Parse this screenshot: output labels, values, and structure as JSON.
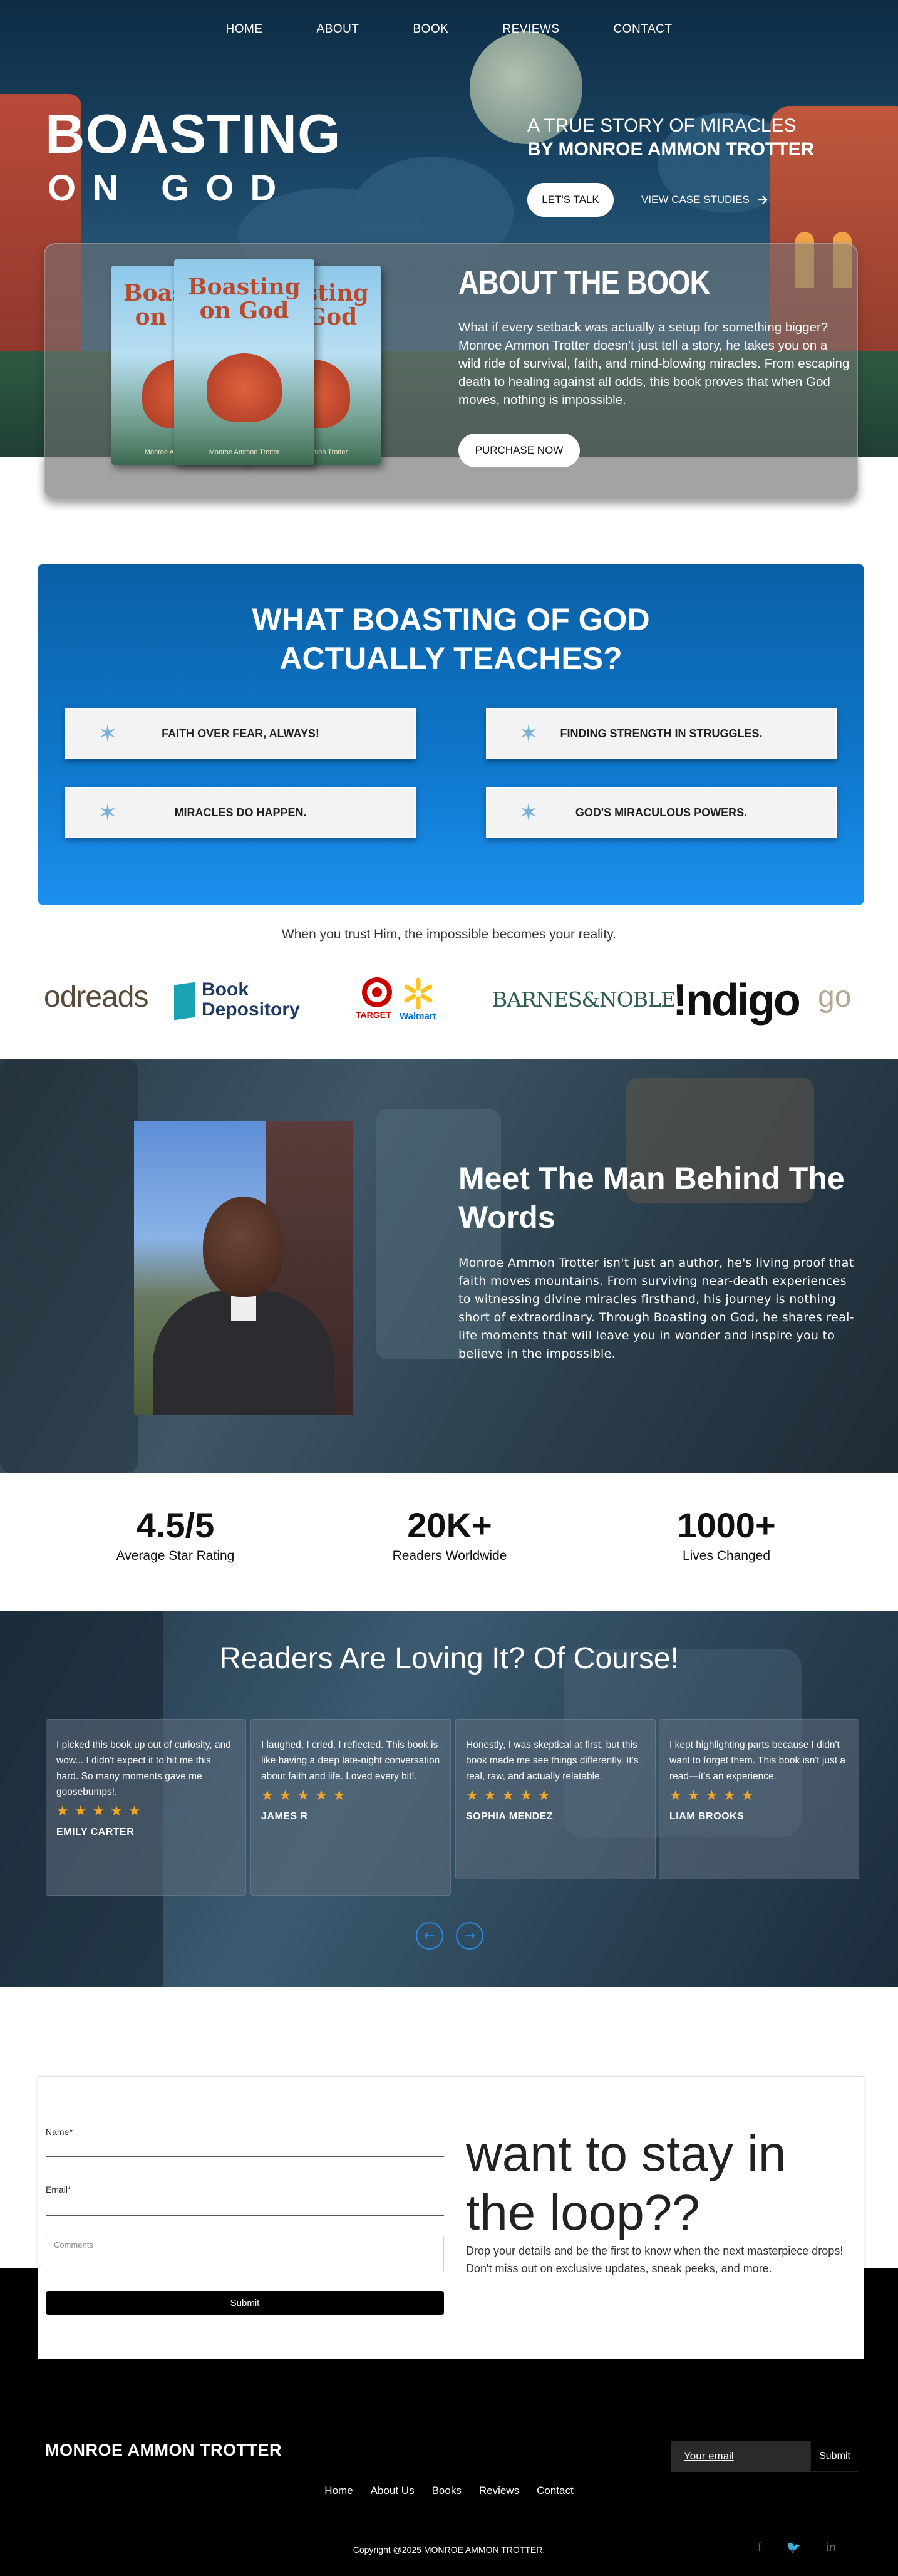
{
  "nav": {
    "items": [
      "HOME",
      "ABOUT",
      "BOOK",
      "REVIEWS",
      "CONTACT"
    ]
  },
  "hero": {
    "brand_line1": "BOASTING",
    "brand_line2": "ON GOD",
    "tagline1": "A TRUE STORY OF MIRACLES",
    "tagline2": "BY MONROE AMMON TROTTER",
    "talk_label": "LET'S TALK",
    "cases_label": "VIEW CASE STUDIES"
  },
  "about": {
    "book_title": "Boasting on God",
    "book_author": "Monroe Ammon Trotter",
    "title": "ABOUT THE BOOK",
    "text": "What if every setback was actually a setup for something bigger? Monroe Ammon Trotter doesn't just tell a story, he takes you on a wild ride of survival, faith, and mind-blowing miracles. From escaping death to healing against all odds, this book proves that when God moves, nothing is impossible.",
    "purchase_label": "PURCHASE NOW"
  },
  "teaches": {
    "title_line1": "WHAT BOASTING OF GOD",
    "title_line2": "ACTUALLY TEACHES?",
    "items": [
      "FAITH OVER FEAR, ALWAYS!",
      "FINDING STRENGTH IN STRUGGLES.",
      "MIRACLES DO HAPPEN.",
      "GOD'S MIRACULOUS POWERS."
    ]
  },
  "trust_line": "When you trust Him, the impossible becomes your reality.",
  "logos": {
    "goodreads_partial": "odreads",
    "book_depository_1": "Book",
    "book_depository_2": "Depository",
    "target": "TARGET",
    "walmart": "Walmart",
    "barnes": "BARNES&NOBLE",
    "indigo": "!ndigo",
    "goodreads_edge": "go"
  },
  "meet": {
    "title": "Meet The Man Behind The Words",
    "text": "Monroe Ammon Trotter isn't just an author, he's living proof that faith moves mountains. From surviving near-death experiences to witnessing divine miracles firsthand, his journey is nothing short of extraordinary. Through Boasting on God, he shares real-life moments that will leave you in wonder and inspire you to believe in the impossible."
  },
  "stats": [
    {
      "num": "4.5/5",
      "cap": "Average Star Rating"
    },
    {
      "num": "20K+",
      "cap": "Readers Worldwide"
    },
    {
      "num": "1000+",
      "cap": "Lives Changed"
    }
  ],
  "reviews": {
    "title": "Readers Are Loving It? Of Course!",
    "stars": "★★★★★",
    "items": [
      {
        "text": "I picked this book up out of curiosity, and wow... I didn't expect it to hit me this hard. So many moments gave me goosebumps!.",
        "name": "EMILY CARTER"
      },
      {
        "text": "I laughed, I cried, I reflected. This book is like having a deep late-night conversation about faith and life. Loved every bit!.",
        "name": "JAMES R"
      },
      {
        "text": "Honestly, I was skeptical at first, but this book made me see things differently. It's real, raw, and actually relatable.",
        "name": "SOPHIA MENDEZ"
      },
      {
        "text": "I kept highlighting parts because I didn't want to forget them. This book isn't just a read—it's an experience.",
        "name": "LIAM BROOKS"
      }
    ],
    "prev_icon": "←",
    "next_icon": "→"
  },
  "form": {
    "name_label": "Name*",
    "email_label": "Email*",
    "comments_placeholder": "Comments",
    "submit_label": "Submit",
    "title": "want to stay in the loop??",
    "text": "Drop your details and be the first to know when the next masterpiece drops! Don't miss out on exclusive updates, sneak peeks, and more."
  },
  "footer": {
    "brand": "MONROE AMMON TROTTER",
    "email_placeholder": "Your email",
    "submit_label": "Submit",
    "links": [
      "Home",
      "About Us",
      "Books",
      "Reviews",
      "Contact"
    ],
    "copyright": "Copyright @2025 MONROE AMMON TROTTER.",
    "socials": [
      "f",
      "🐦",
      "in"
    ]
  },
  "colors": {
    "teach_blue": "#0e78cc",
    "star_gold": "#f5a623",
    "arrow_blue": "#2d8be0"
  }
}
